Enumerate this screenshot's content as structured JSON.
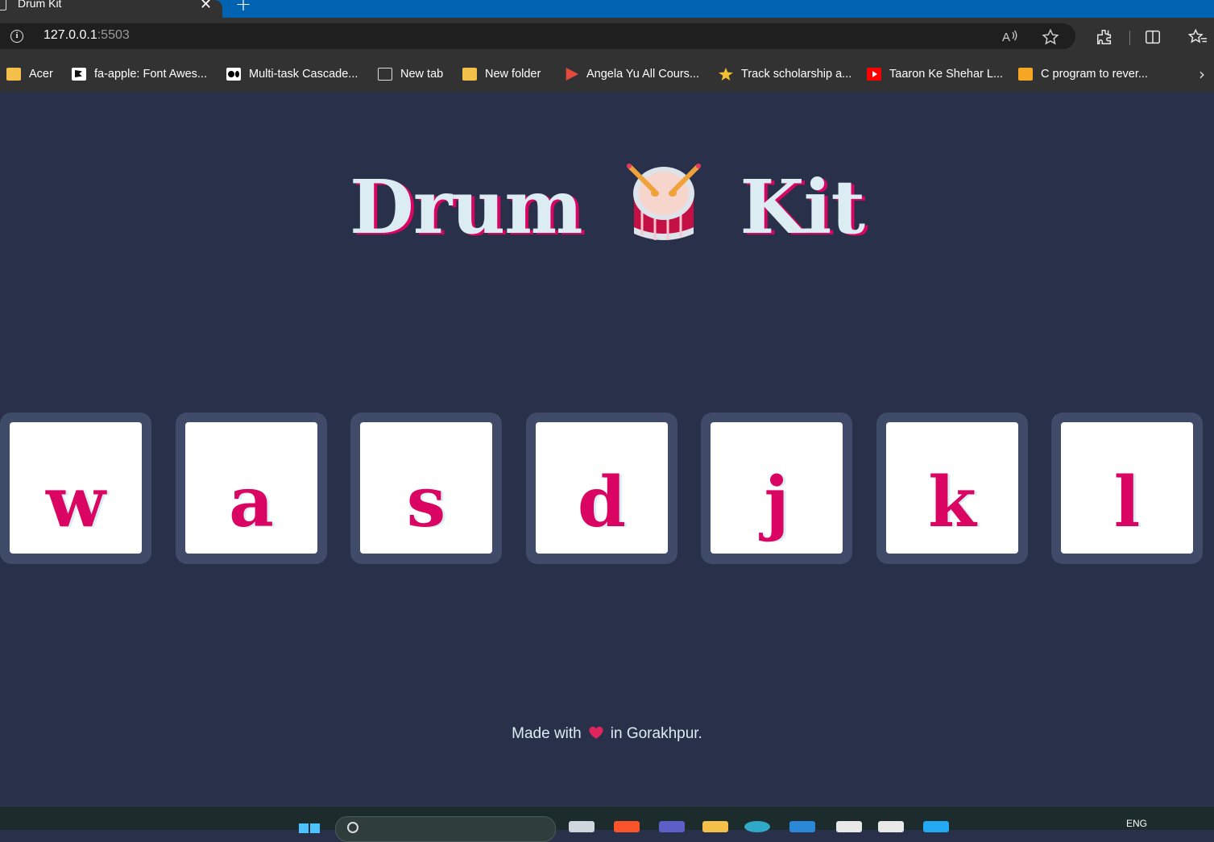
{
  "browser": {
    "tab": {
      "title": "Drum Kit",
      "close_glyph": "✕"
    },
    "new_tab_glyph": "+",
    "url": {
      "host": "127.0.0.1",
      "port": ":5503"
    },
    "bookmarks": [
      {
        "label": "Acer",
        "icon": "folder-icon"
      },
      {
        "label": "fa-apple: Font Awes...",
        "icon": "flag-icon"
      },
      {
        "label": "Multi-task Cascade...",
        "icon": "medium-icon"
      },
      {
        "label": "New tab",
        "icon": "new-tab-icon"
      },
      {
        "label": "New folder",
        "icon": "folder-icon"
      },
      {
        "label": "Angela Yu All Cours...",
        "icon": "udemy-icon"
      },
      {
        "label": "Track scholarship a...",
        "icon": "scholarship-icon"
      },
      {
        "label": "Taaron Ke Shehar L...",
        "icon": "youtube-icon"
      },
      {
        "label": "C program to rever...",
        "icon": "c-program-icon"
      }
    ]
  },
  "page": {
    "title_left": "Drum",
    "title_right": "Kit",
    "keys": [
      "w",
      "a",
      "s",
      "d",
      "j",
      "k",
      "l"
    ],
    "footer": {
      "before": "Made with",
      "after": "in Gorakhpur."
    }
  },
  "taskbar": {
    "language": "ENG"
  },
  "colors": {
    "background": "#283149",
    "key_frame": "#404b69",
    "accent_pink": "#da0463",
    "title_text": "#dbedf3"
  }
}
